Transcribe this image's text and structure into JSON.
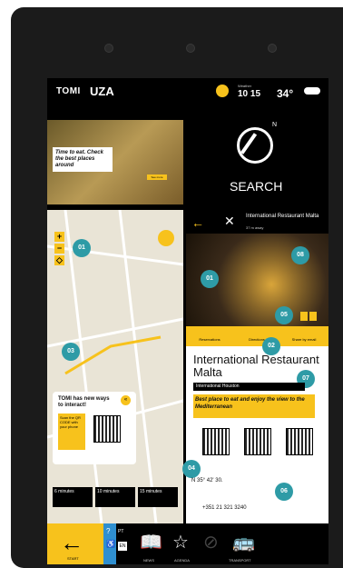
{
  "header": {
    "brand": "TOMI",
    "brand_partner": "UZA",
    "weather_caption": "Weather",
    "time": "10 15",
    "temperature": "34°"
  },
  "banner": {
    "headline": "Time to eat. Check the best places around",
    "button": "See more"
  },
  "search": {
    "label": "SEARCH",
    "compass_letter": "N"
  },
  "map": {
    "zoom_in": "+",
    "zoom_out": "−",
    "interact_title": "TOMI has new ways to interact!",
    "interact_hint": "Scan the QR CODE with your phone",
    "walk_times": [
      {
        "time": "6 minutes"
      },
      {
        "time": "10 minutes"
      },
      {
        "time": "15 minutes"
      }
    ]
  },
  "restaurant": {
    "back": "←",
    "header_title": "International Restaurant Malta",
    "header_sub": "37 m away",
    "name": "International Restaurant Malta",
    "tag": "International Houston",
    "quote": "Best place to eat and enjoy the view to the Mediterranean",
    "actions": [
      {
        "label": "Reservations"
      },
      {
        "label": "Directions"
      },
      {
        "label": "Share by email"
      }
    ],
    "address": "N 35° 42' 30.",
    "phone": "+351 21 321 3240"
  },
  "markers": [
    "01",
    "01",
    "02",
    "03",
    "04",
    "05",
    "06",
    "07",
    "08"
  ],
  "bottom": {
    "start": "START",
    "langs": [
      "PT",
      "EN"
    ],
    "nav": [
      {
        "label": "NEWS"
      },
      {
        "label": "AGENDA"
      },
      {
        "label": "TRANSPORT"
      }
    ]
  }
}
